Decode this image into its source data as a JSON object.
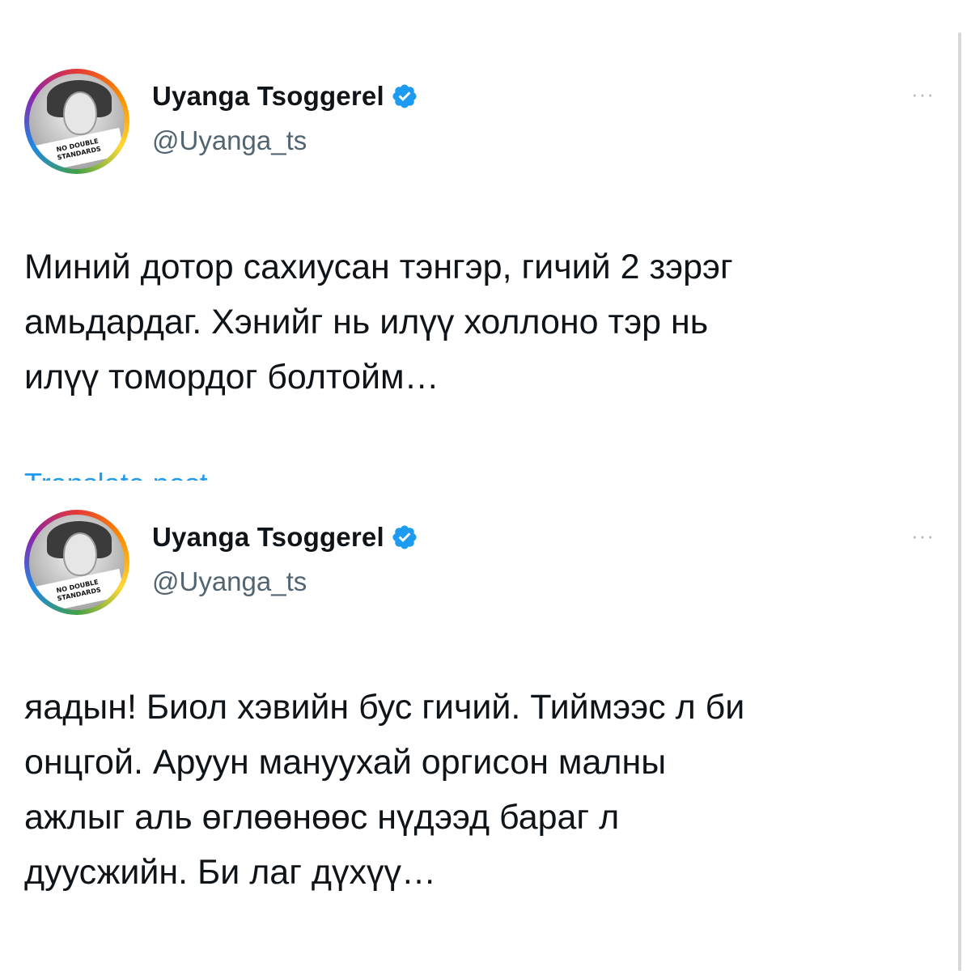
{
  "colors": {
    "link_blue": "#1d9bf0",
    "handle_gray": "#536471",
    "text": "#0f1419",
    "verified_blue": "#1d9bf0"
  },
  "tweets": [
    {
      "author_name": "Uyanga Tsoggerel",
      "handle": "@Uyanga_ts",
      "verified_icon": "verified-badge-icon",
      "avatar_badge_line1": "NO DOUBLE",
      "avatar_badge_line2": "STANDARDS",
      "more_label": "···",
      "text": "Миний дотор сахиусан тэнгэр, гичий 2 зэрэг\nамьдардаг. Хэнийг нь илүү холлоно тэр нь\nилүү томордог болтойм…",
      "translate_label": "Translate post"
    },
    {
      "author_name": "Uyanga Tsoggerel",
      "handle": "@Uyanga_ts",
      "verified_icon": "verified-badge-icon",
      "avatar_badge_line1": "NO DOUBLE",
      "avatar_badge_line2": "STANDARDS",
      "more_label": "···",
      "text": "яадын! Биол хэвийн бус гичий. Тиймээс л би\nонцгой. Аруун мануухай оргисон малны\nажлыг аль өглөөнөөс нүдээд бараг л\nдуусжийн. Би лаг дүхүү…"
    }
  ]
}
